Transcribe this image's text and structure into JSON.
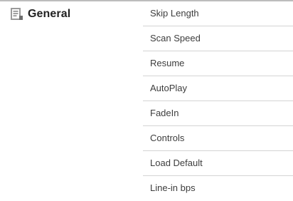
{
  "category": {
    "label": "General",
    "icon": "list-document-icon"
  },
  "menu": {
    "items": [
      {
        "label": "Skip Length"
      },
      {
        "label": "Scan Speed"
      },
      {
        "label": "Resume"
      },
      {
        "label": "AutoPlay"
      },
      {
        "label": "FadeIn"
      },
      {
        "label": "Controls"
      },
      {
        "label": "Load Default"
      },
      {
        "label": "Line-in bps"
      }
    ]
  },
  "colors": {
    "icon_fill": "#8f8f8f",
    "divider": "#d4d4d4",
    "text": "#3d3d3d"
  }
}
